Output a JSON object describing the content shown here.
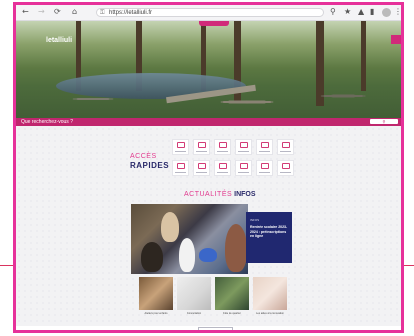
{
  "browser": {
    "url": "https://letalliuli.fr",
    "icons": [
      "back-arrow-icon",
      "forward-arrow-icon",
      "reload-icon",
      "home-icon",
      "lock-icon",
      "zoom-icon",
      "star-icon",
      "extensions-icon",
      "shield-icon",
      "avatar-icon",
      "menu-icon"
    ]
  },
  "hero": {
    "logo": "letalliuli",
    "search_label": "Que recherchez-vous ?"
  },
  "quick_access": {
    "title_line1": "ACCÈS",
    "title_line2": "RAPIDES",
    "tile_count": 12
  },
  "news": {
    "title_part1": "ACTUALITÉS",
    "title_part2": "INFOS",
    "featured": {
      "tag": "INFOS",
      "headline": "Rentrée scolaire 2023-2024 : préinscriptions en ligne"
    },
    "cards": [
      {
        "caption": "Ateliers pour enfants"
      },
      {
        "caption": "Concertation"
      },
      {
        "caption": "Fête de quartier"
      },
      {
        "caption": "Les aides à la rénovation"
      }
    ]
  },
  "colors": {
    "brand_pink": "#e6319a",
    "hero_strip": "#c0266e",
    "navy": "#2a2a6a",
    "feature_card": "#202870"
  }
}
